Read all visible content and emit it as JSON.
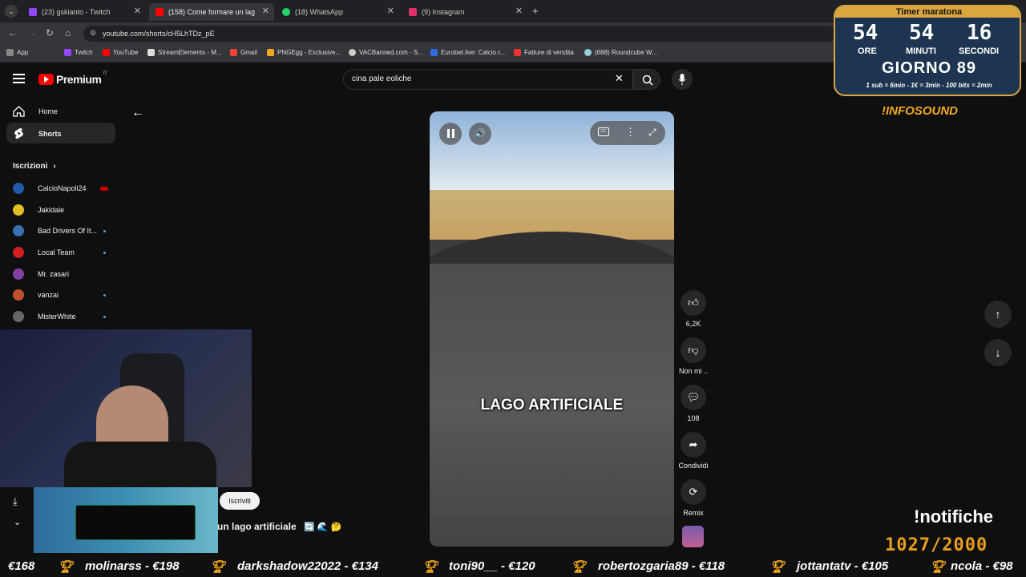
{
  "tabs": [
    {
      "title": "(23) gskianto - Twitch",
      "color": "#9146ff"
    },
    {
      "title": "(158) Come formare un lag",
      "color": "#ff0000"
    },
    {
      "title": "(18) WhatsApp",
      "color": "#25d366"
    },
    {
      "title": "(9) Instagram",
      "color": "#e1306c"
    }
  ],
  "url": "youtube.com/shorts/cH5LhTDz_pE",
  "bookmarks": [
    {
      "label": "App",
      "color": "#888"
    },
    {
      "label": "Twitch",
      "color": "#9146ff"
    },
    {
      "label": "YouTube",
      "color": "#ff0000"
    },
    {
      "label": "StreamElements - M...",
      "color": "#ddd"
    },
    {
      "label": "Gmail",
      "color": "#ea4335"
    },
    {
      "label": "PNGEgg - Exclusive...",
      "color": "#f5a623"
    },
    {
      "label": "VACBanned.com - S...",
      "color": "#ccc"
    },
    {
      "label": "Eurobet.live: Calcio r...",
      "color": "#2d6be0"
    },
    {
      "label": "Fatture di vendita",
      "color": "#e33"
    },
    {
      "label": "(688) Roundcube W...",
      "color": "#9cd"
    }
  ],
  "header": {
    "logo": "Premium",
    "region": "IT",
    "search_value": "cina pale eoliche"
  },
  "sidebar": {
    "home": "Home",
    "shorts": "Shorts",
    "subs_title": "Iscrizioni",
    "channels": [
      {
        "name": "CalcioNapoli24",
        "color": "#1e5aa8"
      },
      {
        "name": "Jakidale",
        "color": "#e0c020"
      },
      {
        "name": "Bad Drivers Of It...",
        "color": "#3a6fb0"
      },
      {
        "name": "Local Team",
        "color": "#d02020"
      },
      {
        "name": "Mr. zasari",
        "color": "#8040a0"
      },
      {
        "name": "vanzai",
        "color": "#c05030"
      },
      {
        "name": "MisterWhite",
        "color": "#666"
      }
    ]
  },
  "video": {
    "caption": "LAGO ARTIFICIALE",
    "title": "un lago artificiale",
    "subscribe": "Iscriviti"
  },
  "actions": {
    "likes": "6,2K",
    "dislike": "Non mi ..",
    "comments": "108",
    "share": "Condividi",
    "remix": "Remix"
  },
  "timer": {
    "title": "Timer maratona",
    "hours": "54",
    "minutes": "54",
    "seconds": "16",
    "hours_label": "ORE",
    "minutes_label": "MINUTI",
    "seconds_label": "SECONDI",
    "day": "GIORNO 89",
    "rules": "1 sub = 6min - 1€ = 3min - 100 bits = 2min"
  },
  "overlay": {
    "infosound": "!INFOSOUND",
    "notif": "!notifiche",
    "notif_count": "1027/2000"
  },
  "ticker": [
    "€168",
    "molinarss - €198",
    "darkshadow22022 - €134",
    "toni90__ - €120",
    "robertozgaria89 - €118",
    "jottantatv - €105",
    "ncola - €98"
  ]
}
